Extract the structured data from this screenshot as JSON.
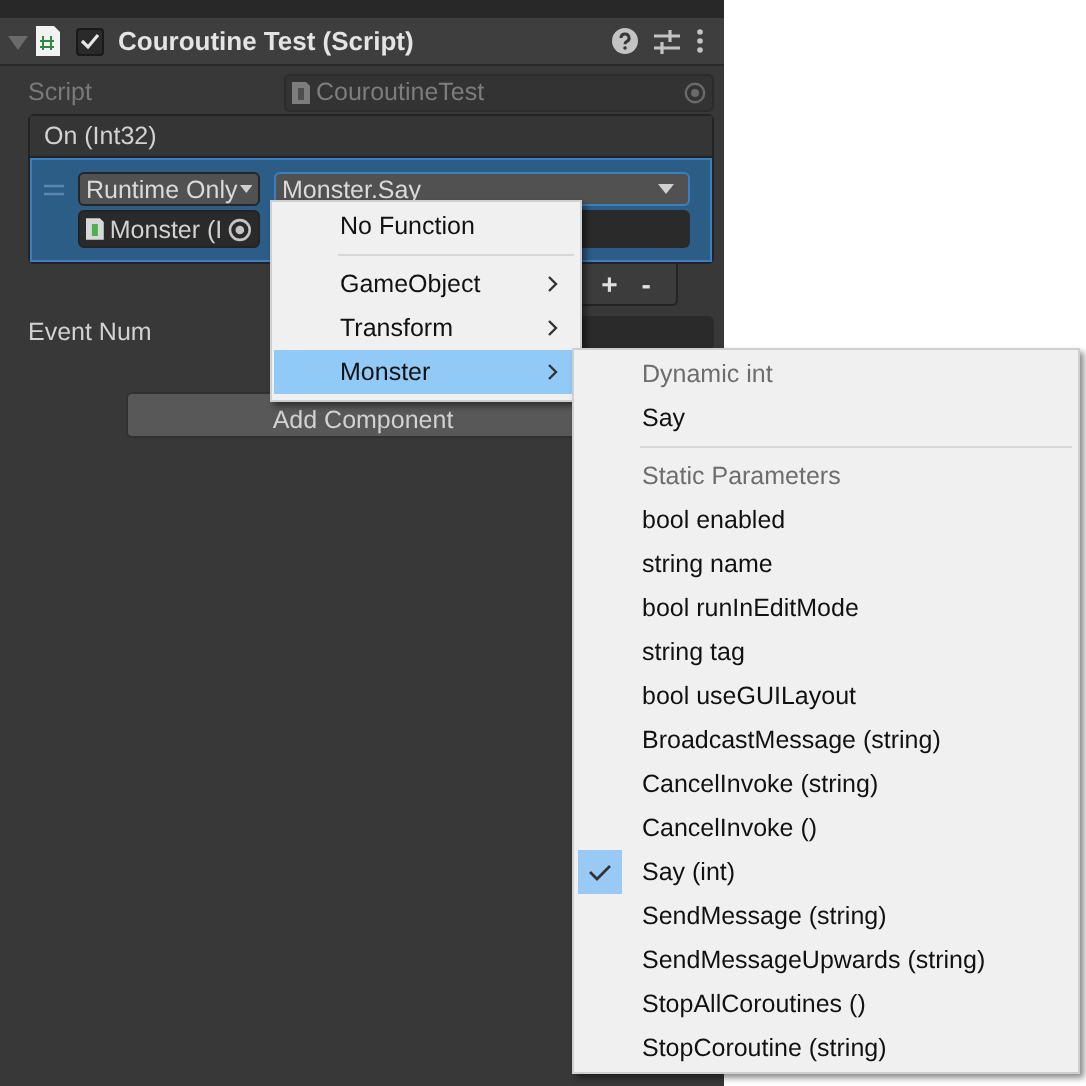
{
  "component": {
    "title": "Couroutine Test (Script)",
    "expanded": true,
    "enabled": true
  },
  "script_field": {
    "label": "Script",
    "value": "CouroutineTest"
  },
  "event": {
    "header": "On (Int32)",
    "mode": "Runtime Only",
    "function": "Monster.Say",
    "target": "Monster (I",
    "add": "+",
    "remove": "-"
  },
  "event_num": {
    "label": "Event Num"
  },
  "add_component": "Add Component",
  "menu": {
    "items": [
      {
        "kind": "item",
        "label": "No Function",
        "selected": false,
        "submenu": false
      },
      {
        "kind": "separator"
      },
      {
        "kind": "item",
        "label": "GameObject",
        "selected": false,
        "submenu": true
      },
      {
        "kind": "item",
        "label": "Transform",
        "selected": false,
        "submenu": true
      },
      {
        "kind": "item",
        "label": "Monster",
        "selected": true,
        "submenu": true
      }
    ]
  },
  "submenu": {
    "items": [
      {
        "kind": "header",
        "label": "Dynamic int"
      },
      {
        "kind": "item",
        "label": "Say",
        "checked": false
      },
      {
        "kind": "separator"
      },
      {
        "kind": "header",
        "label": "Static Parameters"
      },
      {
        "kind": "item",
        "label": "bool enabled",
        "checked": false
      },
      {
        "kind": "item",
        "label": "string name",
        "checked": false
      },
      {
        "kind": "item",
        "label": "bool runInEditMode",
        "checked": false
      },
      {
        "kind": "item",
        "label": "string tag",
        "checked": false
      },
      {
        "kind": "item",
        "label": "bool useGUILayout",
        "checked": false
      },
      {
        "kind": "item",
        "label": "BroadcastMessage (string)",
        "checked": false
      },
      {
        "kind": "item",
        "label": "CancelInvoke (string)",
        "checked": false
      },
      {
        "kind": "item",
        "label": "CancelInvoke ()",
        "checked": false
      },
      {
        "kind": "item",
        "label": "Say (int)",
        "checked": true
      },
      {
        "kind": "item",
        "label": "SendMessage (string)",
        "checked": false
      },
      {
        "kind": "item",
        "label": "SendMessageUpwards (string)",
        "checked": false
      },
      {
        "kind": "item",
        "label": "StopAllCoroutines ()",
        "checked": false
      },
      {
        "kind": "item",
        "label": "StopCoroutine (string)",
        "checked": false
      }
    ]
  }
}
